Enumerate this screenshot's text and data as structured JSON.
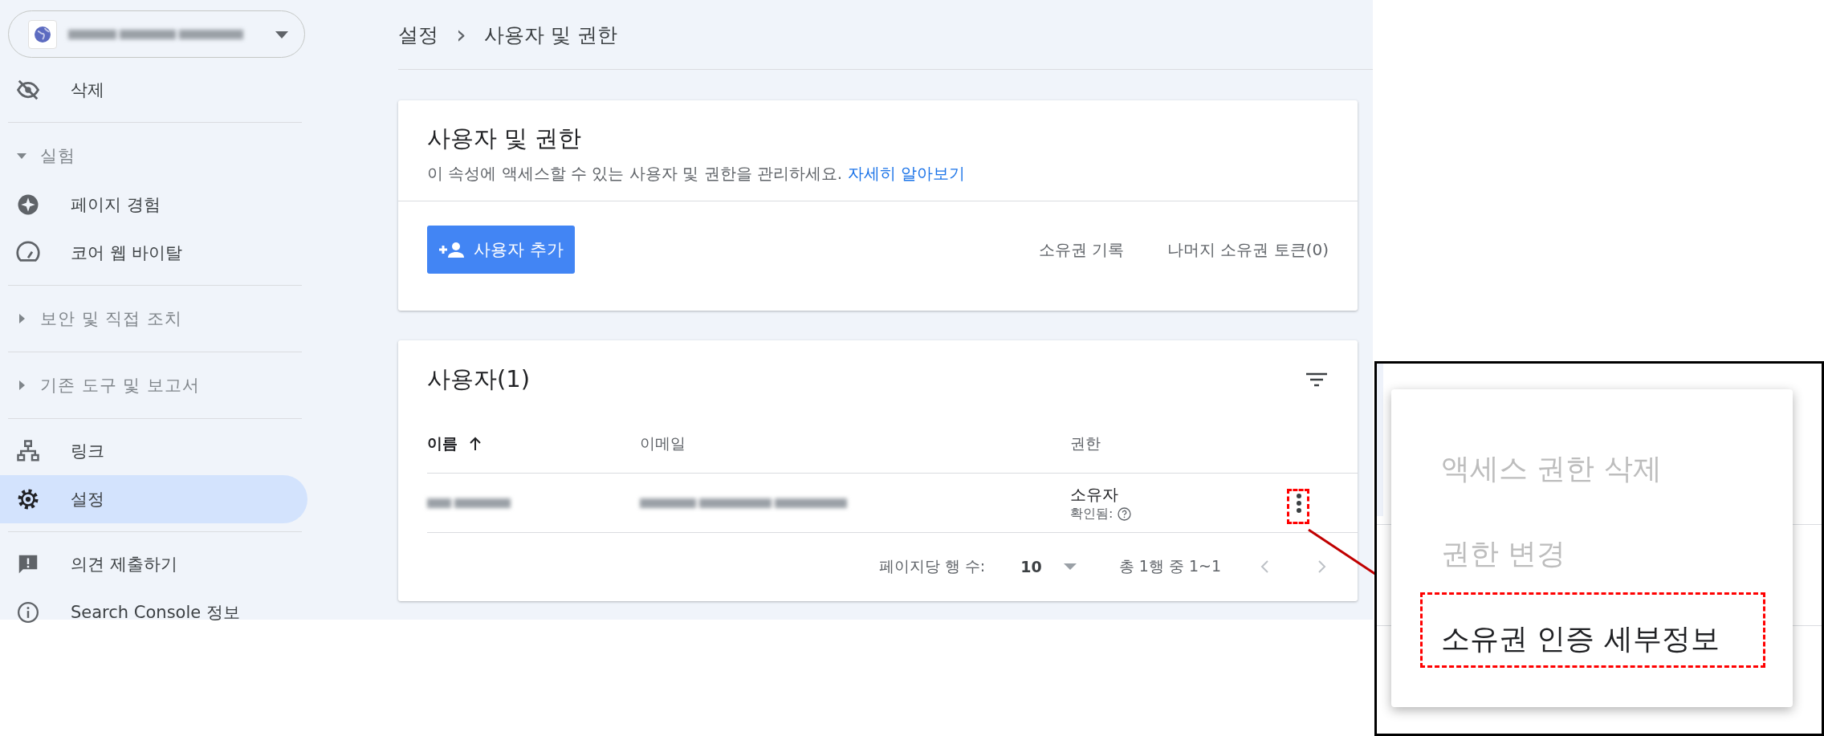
{
  "sidebar": {
    "groups": [
      [
        {
          "kind": "item",
          "label": "삭제",
          "selected": false
        }
      ],
      [
        {
          "kind": "section",
          "label": "실험",
          "expanded": true
        },
        {
          "kind": "item",
          "label": "페이지 경험",
          "selected": false
        },
        {
          "kind": "item",
          "label": "코어 웹 바이탈",
          "selected": false
        }
      ],
      [
        {
          "kind": "section",
          "label": "보안 및 직접 조치",
          "expanded": false
        }
      ],
      [
        {
          "kind": "section",
          "label": "기존 도구 및 보고서",
          "expanded": false
        }
      ],
      [
        {
          "kind": "item",
          "label": "링크",
          "selected": false
        },
        {
          "kind": "item",
          "label": "설정",
          "selected": true
        }
      ],
      [
        {
          "kind": "item",
          "label": "의견 제출하기",
          "selected": false
        },
        {
          "kind": "item",
          "label": "Search Console 정보",
          "selected": false
        }
      ]
    ]
  },
  "breadcrumb": {
    "items": [
      "설정",
      "사용자 및 권한"
    ],
    "separator": "›"
  },
  "intro_card": {
    "title": "사용자 및 권한",
    "description": "이 속성에 액세스할 수 있는 사용자 및 권한을 관리하세요.",
    "link": "자세히 알아보기",
    "add_button": "사용자 추가",
    "actions": [
      "소유권 기록",
      "나머지 소유권 토큰(0)"
    ]
  },
  "users_card": {
    "title": "사용자(1)",
    "columns": [
      {
        "label": "이름",
        "sorted": true
      },
      {
        "label": "이메일",
        "sorted": false
      },
      {
        "label": "권한",
        "sorted": false
      }
    ],
    "rows": [
      {
        "permission": "소유자",
        "status": "확인됨:"
      }
    ],
    "pagination": {
      "rows_per_page_label": "페이지당 행 수:",
      "rows_per_page": "10",
      "range": "총 1행 중 1~1",
      "prev_disabled": true,
      "next_disabled": true
    }
  },
  "zoom_inset": {
    "menu": [
      {
        "label": "액세스 권한 삭제",
        "disabled": true
      },
      {
        "label": "권한 변경",
        "disabled": true
      },
      {
        "label": "소유권 인증 세부정보",
        "disabled": false
      }
    ]
  }
}
